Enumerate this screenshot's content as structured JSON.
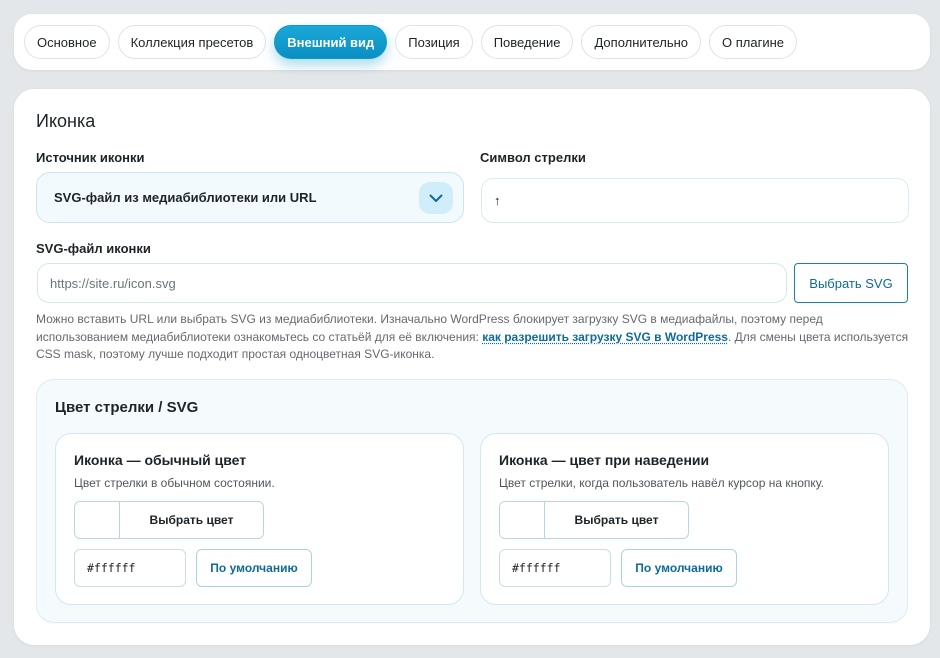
{
  "tabs": [
    {
      "label": "Основное",
      "active": false
    },
    {
      "label": "Коллекция пресетов",
      "active": false
    },
    {
      "label": "Внешний вид",
      "active": true
    },
    {
      "label": "Позиция",
      "active": false
    },
    {
      "label": "Поведение",
      "active": false
    },
    {
      "label": "Дополнительно",
      "active": false
    },
    {
      "label": "О плагине",
      "active": false
    }
  ],
  "icon_section": {
    "title": "Иконка",
    "source_label": "Источник иконки",
    "source_value": "SVG-файл из медиабиблиотеки или URL",
    "arrow_symbol_label": "Символ стрелки",
    "arrow_symbol_value": "↑",
    "svg_file_label": "SVG-файл иконки",
    "svg_placeholder": "https://site.ru/icon.svg",
    "choose_svg_button": "Выбрать SVG",
    "help_text_before": "Можно вставить URL или выбрать SVG из медиабиблиотеки. Изначально WordPress блокирует загрузку SVG в медиафайлы, поэтому перед использованием медиабиблиотеки ознакомьтесь со статьёй для её включения: ",
    "help_link": "как разрешить загрузку SVG в WordPress",
    "help_text_after": ". Для смены цвета используется CSS mask, поэтому лучше подходит простая одноцветная SVG-иконка."
  },
  "color_section": {
    "title": "Цвет стрелки / SVG",
    "normal": {
      "title": "Иконка — обычный цвет",
      "description": "Цвет стрелки в обычном состоянии.",
      "picker_label": "Выбрать цвет",
      "hex_value": "#ffffff",
      "default_button": "По умолчанию"
    },
    "hover": {
      "title": "Иконка — цвет при наведении",
      "description": "Цвет стрелки, когда пользователь навёл курсор на кнопку.",
      "picker_label": "Выбрать цвет",
      "hex_value": "#ffffff",
      "default_button": "По умолчанию"
    }
  },
  "icons": {
    "select_chevron": "chevron-down-icon"
  },
  "colors": {
    "accent": "#0e9acb",
    "link": "#0f6a9a"
  }
}
